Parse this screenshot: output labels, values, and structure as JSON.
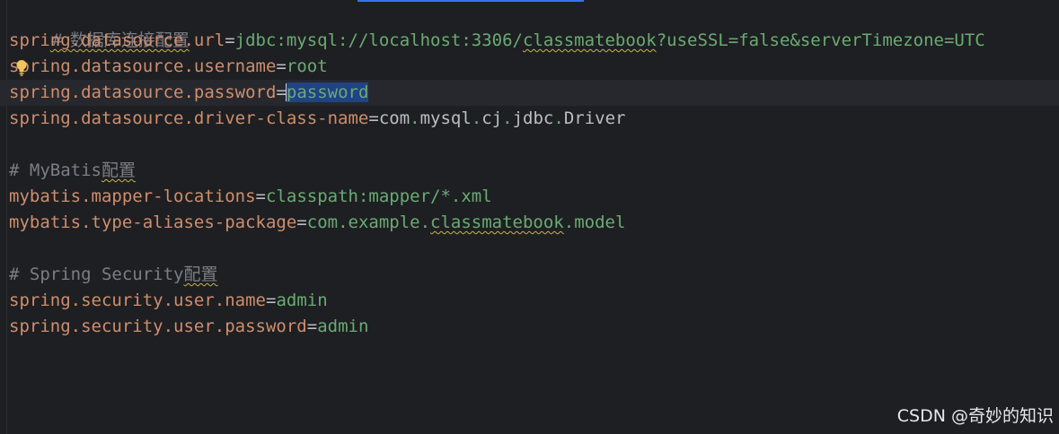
{
  "editor": {
    "lines": [
      {
        "comment": "# 数据库连接配置"
      },
      {
        "key": "spring.datasource.url",
        "eq": "=",
        "value_pre": "jdbc:mysql://localhost:3306/",
        "value_typo": "classmatebook",
        "value_post": "?useSSL=false&serverTimezone=UTC"
      },
      {
        "key": "spring.datasource.username",
        "eq": "=",
        "value": "root"
      },
      {
        "key": "spring.datasource.password",
        "eq": "=",
        "value": "password"
      },
      {
        "key": "spring.datasource.driver-class-name",
        "eq": "=",
        "value_parts": [
          "com",
          ".",
          "mysql",
          ".",
          "cj",
          ".",
          "jdbc",
          ".",
          "Driver"
        ]
      },
      {
        "comment_prefix": "# MyBatis",
        "comment_cjk": "配置"
      },
      {
        "key": "mybatis.mapper-locations",
        "eq": "=",
        "value": "classpath:mapper/*.xml"
      },
      {
        "key": "mybatis.type-aliases-package",
        "eq": "=",
        "value_pre": "com.example.",
        "value_typo": "classmatebook",
        "value_post": ".model"
      },
      {
        "comment_prefix": "# Spring Security",
        "comment_cjk": "配置"
      },
      {
        "key": "spring.security.user.name",
        "eq": "=",
        "value": "admin"
      },
      {
        "key": "spring.security.user.password",
        "eq": "=",
        "value": "admin"
      }
    ]
  },
  "icons": {
    "intention": "lightbulb-icon"
  },
  "colors": {
    "background": "#1e1f22",
    "key": "#cf8e6d",
    "value": "#6aab73",
    "comment": "#7a7e85",
    "selection": "#214283",
    "bulb": "#f2c55c"
  },
  "watermark": "CSDN @奇妙的知识"
}
